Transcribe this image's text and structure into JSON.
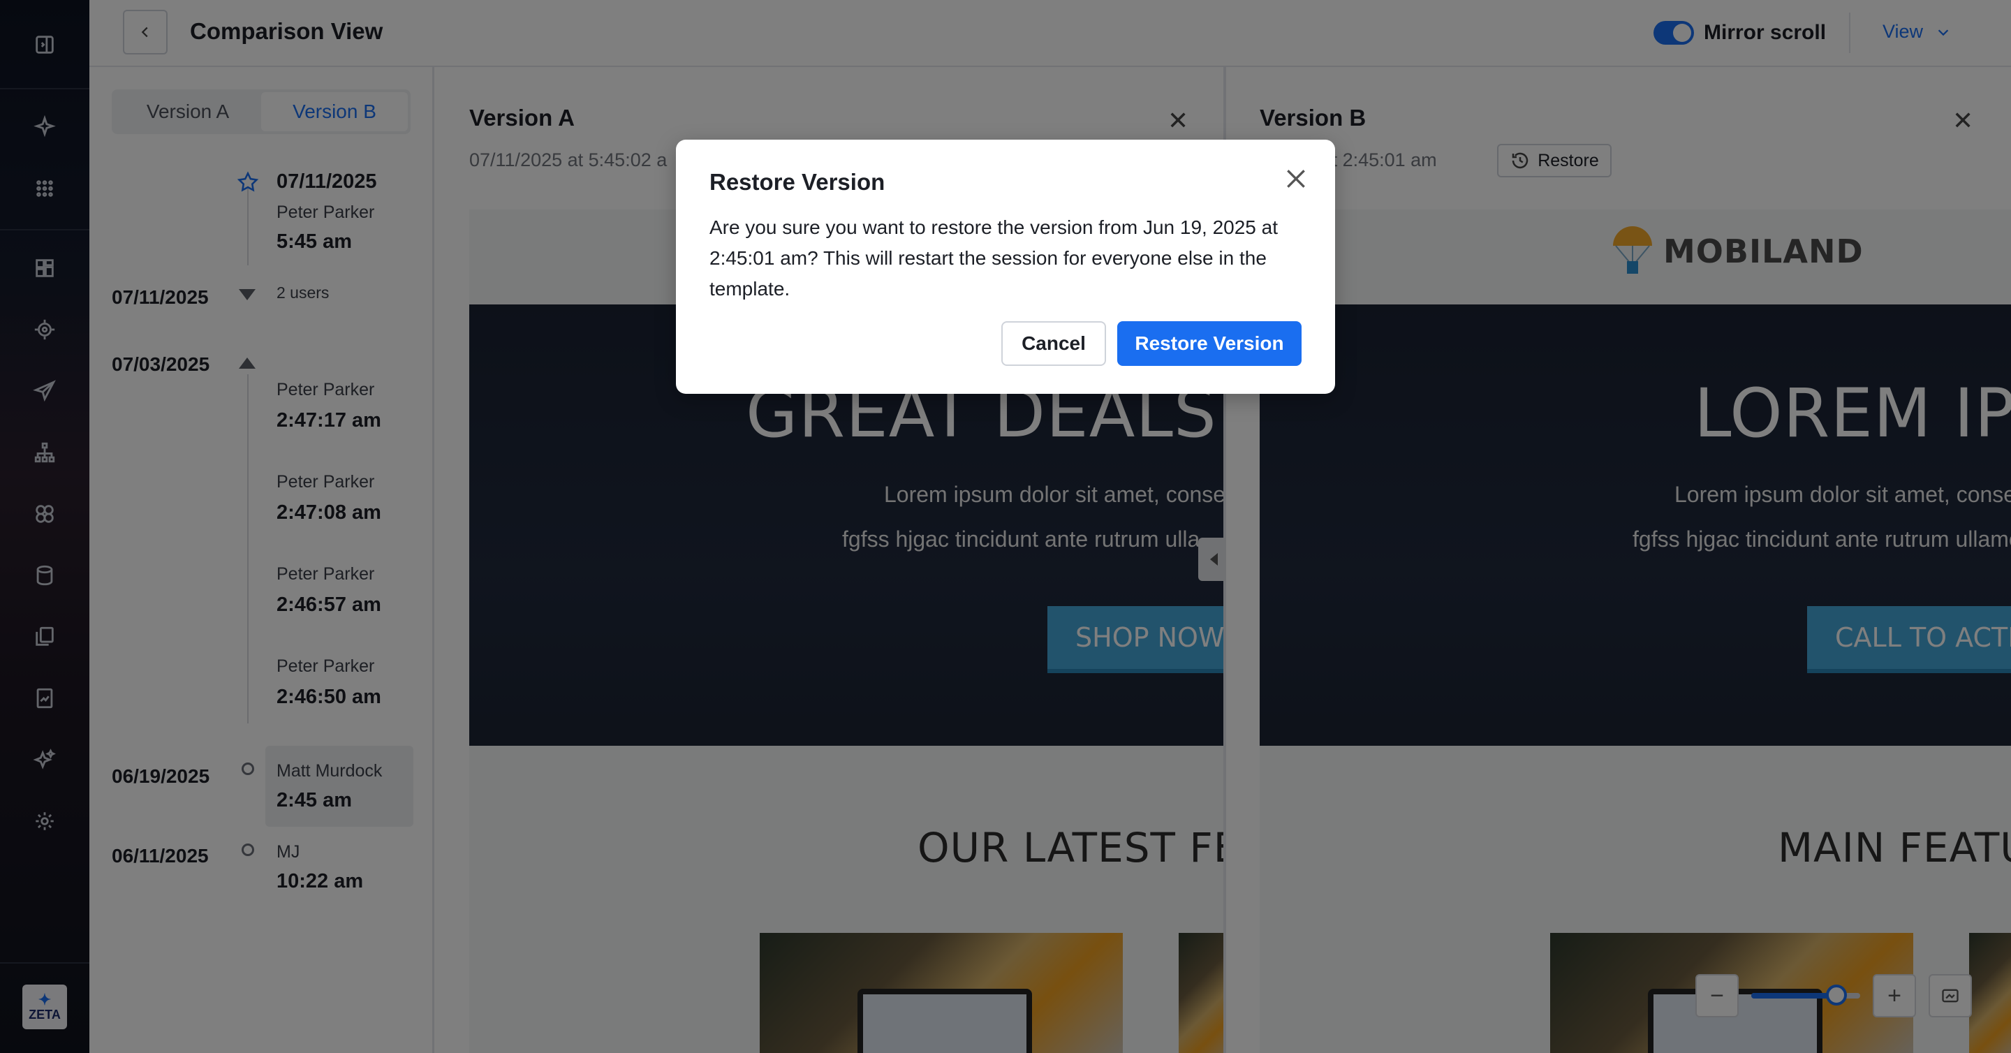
{
  "header": {
    "title": "Comparison View",
    "mirror_scroll_label": "Mirror scroll",
    "mirror_scroll_on": true,
    "view_label": "View"
  },
  "history": {
    "segments": [
      "Version A",
      "Version B"
    ],
    "active_segment": "Version B",
    "entries": [
      {
        "date": "",
        "head_date": "07/11/2025",
        "user": "Peter Parker",
        "time": "5:45 am",
        "starred": true
      },
      {
        "date": "07/11/2025",
        "collapsed_label": "2 users"
      },
      {
        "date": "07/03/2025"
      },
      {
        "user": "Peter Parker",
        "time": "2:47:17 am"
      },
      {
        "user": "Peter Parker",
        "time": "2:47:08 am"
      },
      {
        "user": "Peter Parker",
        "time": "2:46:57 am"
      },
      {
        "user": "Peter Parker",
        "time": "2:46:50 am"
      },
      {
        "date": "06/19/2025",
        "user": "Matt Murdock",
        "time": "2:45 am",
        "selected": true
      },
      {
        "date": "06/11/2025",
        "user": "MJ",
        "time": "10:22 am"
      }
    ]
  },
  "pane_a": {
    "title": "Version A",
    "subtitle": "07/11/2025 at 5:45:02 a",
    "hero_title": "GREAT DEALS",
    "hero_line1": "Lorem ipsum dolor sit amet, consec",
    "hero_line2": "fgfss hjgac tincidunt ante rutrum ulla",
    "cta": "SHOP NOW",
    "section_title": "OUR LATEST FE"
  },
  "pane_b": {
    "title": "Version B",
    "subtitle": "025 at 2:45:01 am",
    "restore_label": "Restore",
    "logo_text": "MOBILAND",
    "hero_title": "LOREM IP",
    "hero_line1": "Lorem ipsum dolor sit amet, consec",
    "hero_line2": "fgfss hjgac tincidunt ante rutrum ullame",
    "cta": "CALL TO ACTIO",
    "section_title": "MAIN FEATU"
  },
  "zoom": {
    "level_fraction": 0.78
  },
  "modal": {
    "title": "Restore Version",
    "body": "Are you sure you want to restore the version from Jun 19, 2025 at 2:45:01 am? This will restart the session for everyone else in the template.",
    "cancel_label": "Cancel",
    "confirm_label": "Restore Version"
  },
  "brand": {
    "logo_text": "ZETA",
    "accent": "#1a6ef0"
  }
}
